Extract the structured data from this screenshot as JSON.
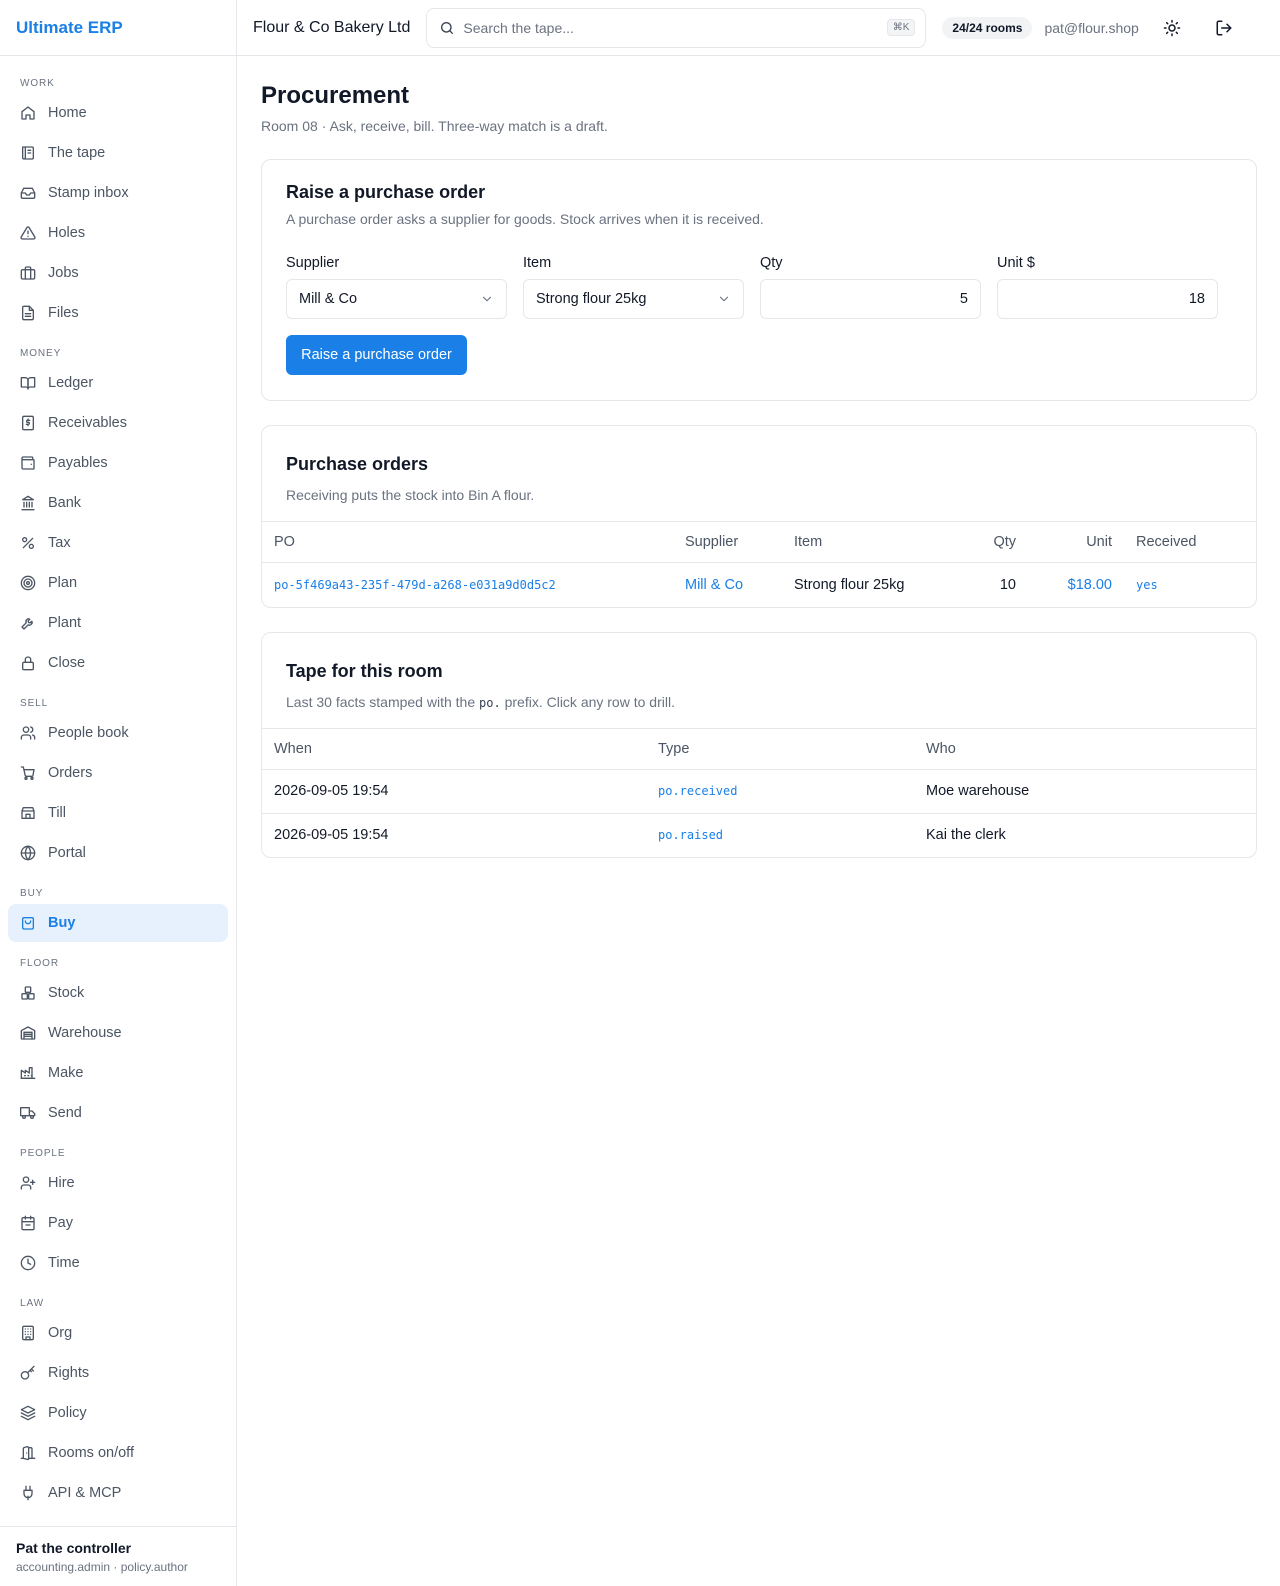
{
  "app": {
    "brand": "Ultimate ERP"
  },
  "topbar": {
    "company": "Flour & Co Bakery Ltd",
    "search_placeholder": "Search the tape...",
    "shortcut": "⌘K",
    "rooms": "24/24 rooms",
    "email": "pat@flour.shop"
  },
  "sidebar": {
    "sections": [
      {
        "label": "WORK",
        "items": [
          {
            "label": "Home",
            "icon": "home-icon"
          },
          {
            "label": "The tape",
            "icon": "scroll-icon"
          },
          {
            "label": "Stamp inbox",
            "icon": "inbox-icon"
          },
          {
            "label": "Holes",
            "icon": "alert-triangle-icon"
          },
          {
            "label": "Jobs",
            "icon": "briefcase-icon"
          },
          {
            "label": "Files",
            "icon": "file-icon"
          }
        ]
      },
      {
        "label": "MONEY",
        "items": [
          {
            "label": "Ledger",
            "icon": "book-open-icon"
          },
          {
            "label": "Receivables",
            "icon": "receipt-icon"
          },
          {
            "label": "Payables",
            "icon": "wallet-icon"
          },
          {
            "label": "Bank",
            "icon": "landmark-icon"
          },
          {
            "label": "Tax",
            "icon": "percent-icon"
          },
          {
            "label": "Plan",
            "icon": "target-icon"
          },
          {
            "label": "Plant",
            "icon": "wrench-icon"
          },
          {
            "label": "Close",
            "icon": "lock-icon"
          }
        ]
      },
      {
        "label": "SELL",
        "items": [
          {
            "label": "People book",
            "icon": "users-icon"
          },
          {
            "label": "Orders",
            "icon": "cart-icon"
          },
          {
            "label": "Till",
            "icon": "store-icon"
          },
          {
            "label": "Portal",
            "icon": "globe-icon"
          }
        ]
      },
      {
        "label": "BUY",
        "items": [
          {
            "label": "Buy",
            "icon": "shopping-bag-icon",
            "active": true
          }
        ]
      },
      {
        "label": "FLOOR",
        "items": [
          {
            "label": "Stock",
            "icon": "boxes-icon"
          },
          {
            "label": "Warehouse",
            "icon": "warehouse-icon"
          },
          {
            "label": "Make",
            "icon": "factory-icon"
          },
          {
            "label": "Send",
            "icon": "truck-icon"
          }
        ]
      },
      {
        "label": "PEOPLE",
        "items": [
          {
            "label": "Hire",
            "icon": "user-plus-icon"
          },
          {
            "label": "Pay",
            "icon": "calendar-icon"
          },
          {
            "label": "Time",
            "icon": "clock-icon"
          }
        ]
      },
      {
        "label": "LAW",
        "items": [
          {
            "label": "Org",
            "icon": "building-icon"
          },
          {
            "label": "Rights",
            "icon": "key-icon"
          },
          {
            "label": "Policy",
            "icon": "layers-icon"
          },
          {
            "label": "Rooms on/off",
            "icon": "door-icon"
          },
          {
            "label": "API & MCP",
            "icon": "plug-icon"
          }
        ]
      }
    ],
    "user": {
      "name": "Pat the controller",
      "roles": "accounting.admin · policy.author"
    }
  },
  "page": {
    "title": "Procurement",
    "subtitle": "Room 08 · Ask, receive, bill. Three-way match is a draft."
  },
  "po_form": {
    "title": "Raise a purchase order",
    "description": "A purchase order asks a supplier for goods. Stock arrives when it is received.",
    "supplier_label": "Supplier",
    "supplier_value": "Mill & Co",
    "item_label": "Item",
    "item_value": "Strong flour 25kg",
    "qty_label": "Qty",
    "qty_value": "5",
    "unit_label": "Unit $",
    "unit_value": "18",
    "submit_label": "Raise a purchase order"
  },
  "po_list": {
    "title": "Purchase orders",
    "description": "Receiving puts the stock into Bin A flour.",
    "columns": [
      "PO",
      "Supplier",
      "Item",
      "Qty",
      "Unit",
      "Received"
    ],
    "rows": [
      {
        "po": "po-5f469a43-235f-479d-a268-e031a9d0d5c2",
        "supplier": "Mill & Co",
        "item": "Strong flour 25kg",
        "qty": "10",
        "unit": "$18.00",
        "received": "yes"
      }
    ]
  },
  "tape": {
    "title": "Tape for this room",
    "desc_before": "Last 30 facts stamped with the",
    "desc_code": "po.",
    "desc_after": "prefix. Click any row to drill.",
    "columns": [
      "When",
      "Type",
      "Who"
    ],
    "rows": [
      {
        "when": "2026-09-05 19:54",
        "type": "po.received",
        "who": "Moe warehouse"
      },
      {
        "when": "2026-09-05 19:54",
        "type": "po.raised",
        "who": "Kai the clerk"
      }
    ]
  },
  "colors": {
    "accent": "#1a7fe6",
    "border": "#e5e7eb",
    "muted": "#6b7280",
    "active_bg": "#e6f1fd"
  }
}
